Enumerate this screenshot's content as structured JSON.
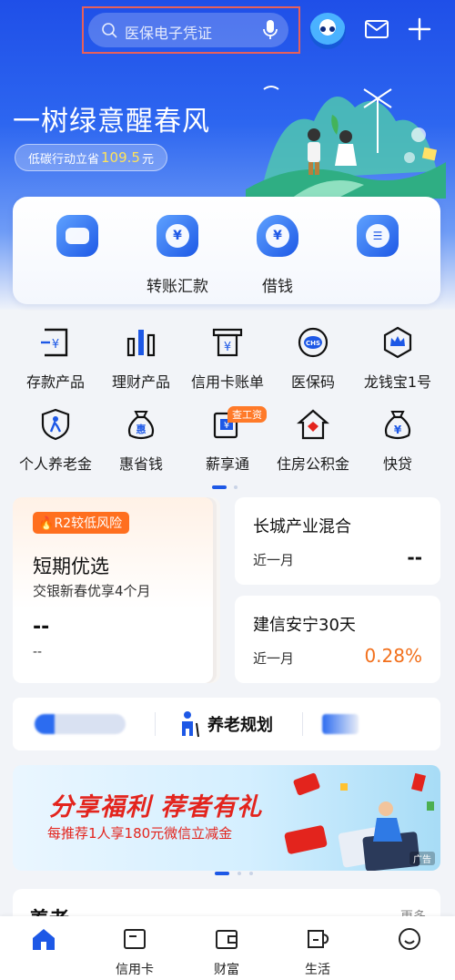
{
  "search": {
    "placeholder": "医保电子凭证"
  },
  "banner": {
    "slogan": "一树绿意醒春风",
    "pill_prefix": "低碳行动立省",
    "pill_amount": "109.5",
    "pill_unit": "元"
  },
  "quick_actions": [
    {
      "label": "",
      "icon": "wallet-icon"
    },
    {
      "label": "转账汇款",
      "icon": "yen-transfer-icon"
    },
    {
      "label": "借钱",
      "icon": "yen-bag-icon"
    },
    {
      "label": "",
      "icon": "card-icon"
    }
  ],
  "grid": [
    {
      "label": "存款产品",
      "icon": "deposit-icon"
    },
    {
      "label": "理财产品",
      "icon": "bar-chart-icon"
    },
    {
      "label": "信用卡账单",
      "icon": "bill-icon"
    },
    {
      "label": "医保码",
      "icon": "chs-icon"
    },
    {
      "label": "龙钱宝1号",
      "icon": "crown-shield-icon"
    },
    {
      "label": "个人养老金",
      "icon": "pension-shield-icon"
    },
    {
      "label": "惠省钱",
      "icon": "hui-bag-icon"
    },
    {
      "label": "薪享通",
      "icon": "salary-icon"
    },
    {
      "label": "住房公积金",
      "icon": "house-fund-icon"
    },
    {
      "label": "快贷",
      "icon": "loan-bag-icon"
    }
  ],
  "grid_tag": "查工资",
  "products": {
    "featured": {
      "risk": "R2较低风险",
      "title": "短期优选",
      "subtitle": "交银新春优享4个月",
      "value": "--",
      "value_label": "--"
    },
    "items": [
      {
        "title": "长城产业混合",
        "period": "近一月",
        "rate": "--"
      },
      {
        "title": "建信安宁30天",
        "period": "近一月",
        "rate": "0.28%"
      }
    ]
  },
  "strip": {
    "pension_label": "养老规划"
  },
  "ad": {
    "headline": "分享福利 荐者有礼",
    "subtitle": "每推荐1人享180元微信立减金",
    "badge": "广告"
  },
  "section": {
    "title": "养老",
    "more": "更多"
  },
  "nav": [
    {
      "label": "",
      "icon": "home-icon",
      "active": true
    },
    {
      "label": "信用卡",
      "icon": "credit-card-icon"
    },
    {
      "label": "财富",
      "icon": "wallet-nav-icon"
    },
    {
      "label": "生活",
      "icon": "cup-icon"
    },
    {
      "label": "",
      "icon": "smile-icon"
    }
  ],
  "colors": {
    "primary": "#1d58e6",
    "accent_orange": "#f2701c",
    "ad_red": "#e3241d"
  }
}
